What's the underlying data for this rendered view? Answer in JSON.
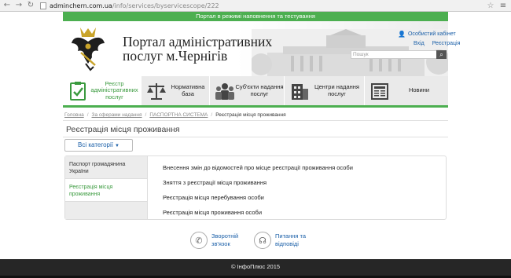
{
  "browser": {
    "url_host": "adminchern.com.ua",
    "url_path": "/info/services/byservicescope/222"
  },
  "banner": {
    "text": "Портал в режимі наповнення та тестування"
  },
  "header": {
    "title_line1": "Портал адміністративних",
    "title_line2": "послуг м.Чернігів",
    "cabinet": "Особистий кабінет",
    "login": "Вхід",
    "register": "Реєстрація",
    "search_placeholder": "Пошук"
  },
  "nav": [
    {
      "label": "Реєстр адміністративних послуг",
      "icon": "clipboard-check-icon"
    },
    {
      "label": "Нормативна база",
      "icon": "scales-icon"
    },
    {
      "label": "Суб'єкти надання послуг",
      "icon": "people-icon"
    },
    {
      "label": "Центри надання послуг",
      "icon": "building-icon"
    },
    {
      "label": "Новини",
      "icon": "newspaper-icon"
    }
  ],
  "breadcrumb": {
    "home": "Головна",
    "scope": "За сферами надання",
    "section": "ПАСПОРТНА СИСТЕМА",
    "current": "Реєстрація місця проживання"
  },
  "page_title": "Реєстрація місця проживання",
  "category_select": {
    "label": "Всі категорії"
  },
  "sidebar": [
    {
      "label": "Паспорт громадянина України"
    },
    {
      "label": "Реєстрація місця проживання"
    }
  ],
  "services": [
    "Внесення змін до відомостей про місце реєстрації проживання особи",
    "Зняття з реєстрації місця проживання",
    "Реєстрація місця перебування особи",
    "Реєстрація місця проживання особи"
  ],
  "feedback": {
    "left_line1": "Зворотній",
    "left_line2": "зв'язок",
    "right_line1": "Питання та",
    "right_line2": "відповіді"
  },
  "footer": {
    "text": "© ІнфоПлюс 2015"
  },
  "colors": {
    "accent": "#4caf50",
    "link": "#1a5fa8",
    "footer": "#262626"
  }
}
